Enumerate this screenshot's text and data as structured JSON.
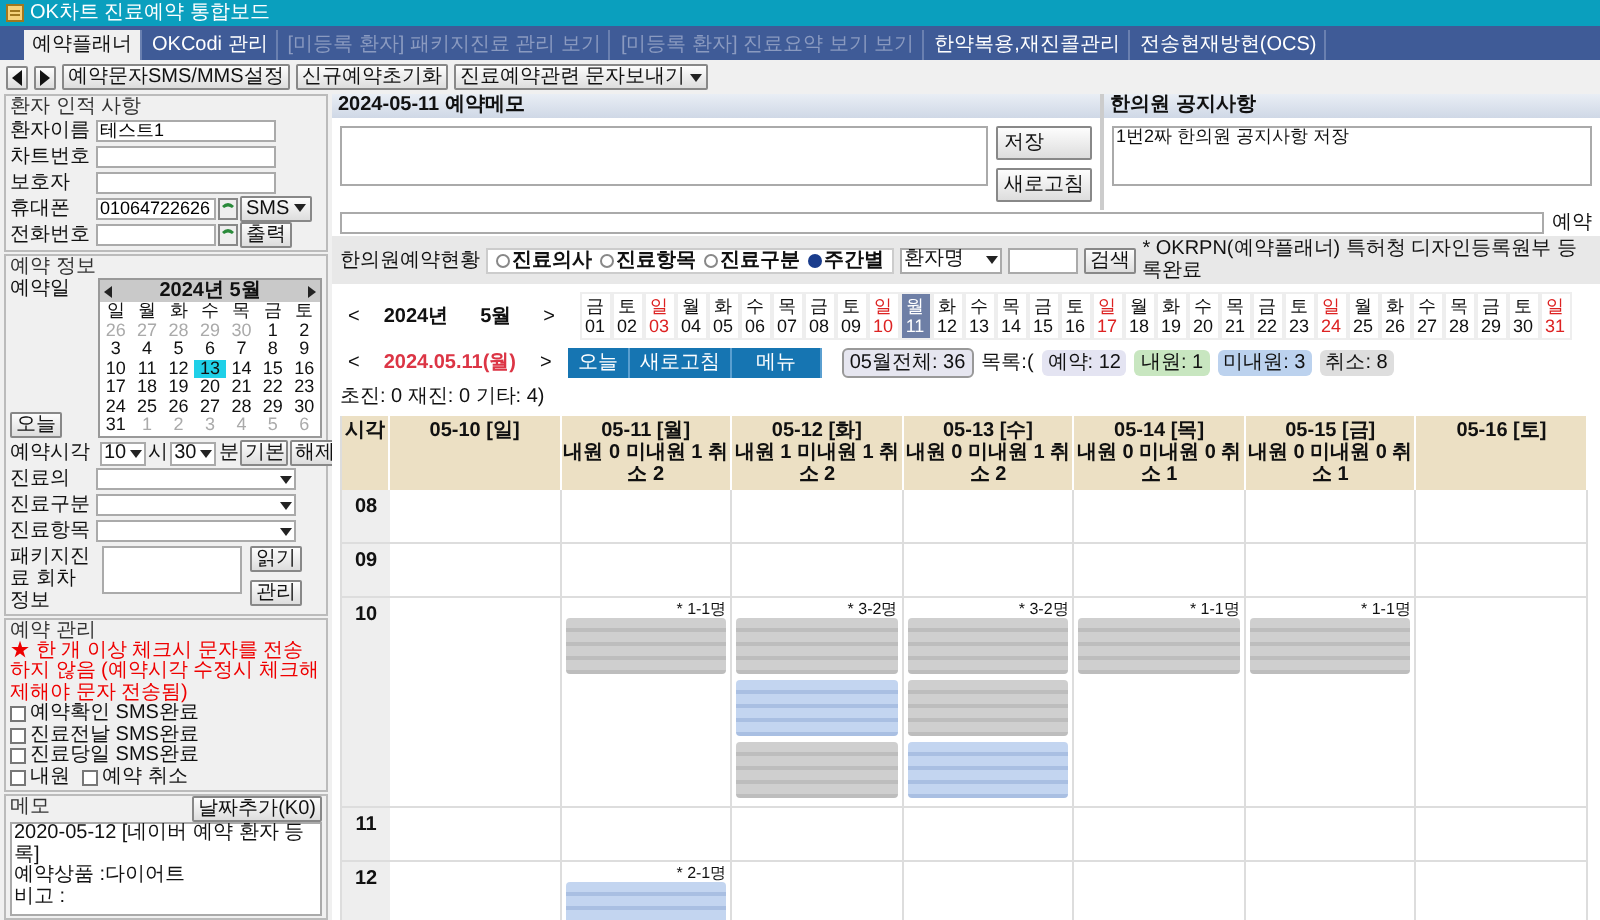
{
  "window": {
    "title": "OK차트 진료예약 통합보드"
  },
  "menu_tabs": [
    {
      "label": "예약플래너",
      "selected": true,
      "disabled": false
    },
    {
      "label": "OKCodi 관리",
      "selected": false,
      "disabled": false
    },
    {
      "label": "[미등록 환자] 패키지진료 관리 보기",
      "selected": false,
      "disabled": true
    },
    {
      "label": "[미등록 환자] 진료요약 보기 보기",
      "selected": false,
      "disabled": true
    },
    {
      "label": "한약복용,재진콜관리",
      "selected": false,
      "disabled": false
    },
    {
      "label": "전송현재방현(OCS)",
      "selected": false,
      "disabled": false
    }
  ],
  "toolbar": {
    "buttons": [
      {
        "kind": "prev"
      },
      {
        "kind": "next"
      },
      {
        "kind": "text",
        "label": "예약문자SMS/MMS설정"
      },
      {
        "kind": "text",
        "label": "신규예약초기화"
      },
      {
        "kind": "dropdown",
        "label": "진료예약관련 문자보내기"
      }
    ]
  },
  "patient": {
    "title": "환자 인적 사항",
    "fields": [
      {
        "label": "환자이름",
        "value": "테스트1",
        "kind": "plain"
      },
      {
        "label": "차트번호",
        "kind": "plain"
      },
      {
        "label": "보호자",
        "kind": "plain"
      },
      {
        "label": "휴대폰",
        "value": "01064722626",
        "kind": "phone",
        "extra": "SMS"
      },
      {
        "label": "전화번호",
        "kind": "phone",
        "extra": "출력"
      }
    ]
  },
  "reservation": {
    "title": "예약 정보",
    "date_label": "예약일",
    "mini_calendar": {
      "title": "2024년 5월",
      "weekdays": [
        "일",
        "월",
        "화",
        "수",
        "목",
        "금",
        "토"
      ],
      "days": [
        {
          "day": "26",
          "other_month": true,
          "selected": false
        },
        {
          "day": "27",
          "other_month": true,
          "selected": false
        },
        {
          "day": "28",
          "other_month": true,
          "selected": false
        },
        {
          "day": "29",
          "other_month": true,
          "selected": false
        },
        {
          "day": "30",
          "other_month": true,
          "selected": false
        },
        {
          "day": "1",
          "other_month": false,
          "selected": false
        },
        {
          "day": "2",
          "other_month": false,
          "selected": false
        },
        {
          "day": "3",
          "other_month": false,
          "selected": false
        },
        {
          "day": "4",
          "other_month": false,
          "selected": false
        },
        {
          "day": "5",
          "other_month": false,
          "selected": false
        },
        {
          "day": "6",
          "other_month": false,
          "selected": false
        },
        {
          "day": "7",
          "other_month": false,
          "selected": false
        },
        {
          "day": "8",
          "other_month": false,
          "selected": false
        },
        {
          "day": "9",
          "other_month": false,
          "selected": false
        },
        {
          "day": "10",
          "other_month": false,
          "selected": false
        },
        {
          "day": "11",
          "other_month": false,
          "selected": false
        },
        {
          "day": "12",
          "other_month": false,
          "selected": false
        },
        {
          "day": "13",
          "other_month": false,
          "selected": true
        },
        {
          "day": "14",
          "other_month": false,
          "selected": false
        },
        {
          "day": "15",
          "other_month": false,
          "selected": false
        },
        {
          "day": "16",
          "other_month": false,
          "selected": false
        },
        {
          "day": "17",
          "other_month": false,
          "selected": false
        },
        {
          "day": "18",
          "other_month": false,
          "selected": false
        },
        {
          "day": "19",
          "other_month": false,
          "selected": false
        },
        {
          "day": "20",
          "other_month": false,
          "selected": false
        },
        {
          "day": "21",
          "other_month": false,
          "selected": false
        },
        {
          "day": "22",
          "other_month": false,
          "selected": false
        },
        {
          "day": "23",
          "other_month": false,
          "selected": false
        },
        {
          "day": "24",
          "other_month": false,
          "selected": false
        },
        {
          "day": "25",
          "other_month": false,
          "selected": false
        },
        {
          "day": "26",
          "other_month": false,
          "selected": false
        },
        {
          "day": "27",
          "other_month": false,
          "selected": false
        },
        {
          "day": "28",
          "other_month": false,
          "selected": false
        },
        {
          "day": "29",
          "other_month": false,
          "selected": false
        },
        {
          "day": "30",
          "other_month": false,
          "selected": false
        },
        {
          "day": "31",
          "other_month": false,
          "selected": false
        },
        {
          "day": "1",
          "other_month": true,
          "selected": false
        },
        {
          "day": "2",
          "other_month": true,
          "selected": false
        },
        {
          "day": "3",
          "other_month": true,
          "selected": false
        },
        {
          "day": "4",
          "other_month": true,
          "selected": false
        },
        {
          "day": "5",
          "other_month": true,
          "selected": false
        },
        {
          "day": "6",
          "other_month": true,
          "selected": false
        }
      ]
    },
    "today_button": "오늘",
    "time": {
      "label": "예약시각",
      "hour": "10",
      "hour_unit": "시",
      "minute": "30",
      "minute_unit": "분",
      "buttons": [
        "기본",
        "해제"
      ]
    },
    "selects": [
      {
        "label": "진료의"
      },
      {
        "label": "진료구분"
      },
      {
        "label": "진료항목"
      }
    ],
    "package": {
      "label": "패키지진료 회차정보",
      "buttons": [
        "읽기",
        "관리"
      ]
    }
  },
  "management": {
    "title": "예약 관리",
    "note": "★ 한 개 이상 체크시 문자를 전송하지 않음 (예약시각 수정시 체크해제해야 문자 전송됨)",
    "checks": [
      {
        "label": "예약확인 SMS완료",
        "checked": false
      },
      {
        "label": "진료전날 SMS완료",
        "checked": false
      },
      {
        "label": "진료당일 SMS완료",
        "checked": false
      },
      {
        "label": "내원",
        "checked": false
      },
      {
        "label": "예약 취소",
        "checked": false
      }
    ]
  },
  "memo": {
    "title": "메모",
    "button": "날짜추가(K0)",
    "lines": [
      "2020-05-12 [네이버 예약 환자 등록]",
      "예약상품 :다이어트",
      "비고 :"
    ]
  },
  "day_memo": {
    "title": "2024-05-11 예약메모",
    "buttons": [
      "저장",
      "새로고침"
    ]
  },
  "notice": {
    "title": "한의원 공지사항",
    "text": "1번2짜 한의원 공지사항 저장"
  },
  "memo_row": {
    "label": "예약"
  },
  "filter": {
    "label": "한의원예약현황",
    "radios": [
      {
        "label": "진료의사",
        "selected": false
      },
      {
        "label": "진료항목",
        "selected": false
      },
      {
        "label": "진료구분",
        "selected": false
      },
      {
        "label": "주간별",
        "selected": true
      }
    ],
    "select": "환자명",
    "search_button": "검색",
    "note": "* OKRPN(예약플래너) 특허청 디자인등록원부 등록완료"
  },
  "month_nav": {
    "prev": "<",
    "year": "2024년",
    "month": "5월",
    "next": ">"
  },
  "date_strip": [
    {
      "weekday": "금",
      "day": "01",
      "selected": false,
      "holiday": false
    },
    {
      "weekday": "토",
      "day": "02",
      "selected": false,
      "holiday": false
    },
    {
      "weekday": "일",
      "day": "03",
      "selected": false,
      "holiday": true
    },
    {
      "weekday": "월",
      "day": "04",
      "selected": false,
      "holiday": false
    },
    {
      "weekday": "화",
      "day": "05",
      "selected": false,
      "holiday": false
    },
    {
      "weekday": "수",
      "day": "06",
      "selected": false,
      "holiday": false
    },
    {
      "weekday": "목",
      "day": "07",
      "selected": false,
      "holiday": false
    },
    {
      "weekday": "금",
      "day": "08",
      "selected": false,
      "holiday": false
    },
    {
      "weekday": "토",
      "day": "09",
      "selected": false,
      "holiday": false
    },
    {
      "weekday": "일",
      "day": "10",
      "selected": false,
      "holiday": true
    },
    {
      "weekday": "월",
      "day": "11",
      "selected": true,
      "holiday": false
    },
    {
      "weekday": "화",
      "day": "12",
      "selected": false,
      "holiday": false
    },
    {
      "weekday": "수",
      "day": "13",
      "selected": false,
      "holiday": false
    },
    {
      "weekday": "목",
      "day": "14",
      "selected": false,
      "holiday": false
    },
    {
      "weekday": "금",
      "day": "15",
      "selected": false,
      "holiday": false
    },
    {
      "weekday": "토",
      "day": "16",
      "selected": false,
      "holiday": false
    },
    {
      "weekday": "일",
      "day": "17",
      "selected": false,
      "holiday": true
    },
    {
      "weekday": "월",
      "day": "18",
      "selected": false,
      "holiday": false
    },
    {
      "weekday": "화",
      "day": "19",
      "selected": false,
      "holiday": false
    },
    {
      "weekday": "수",
      "day": "20",
      "selected": false,
      "holiday": false
    },
    {
      "weekday": "목",
      "day": "21",
      "selected": false,
      "holiday": false
    },
    {
      "weekday": "금",
      "day": "22",
      "selected": false,
      "holiday": false
    },
    {
      "weekday": "토",
      "day": "23",
      "selected": false,
      "holiday": false
    },
    {
      "weekday": "일",
      "day": "24",
      "selected": false,
      "holiday": true
    },
    {
      "weekday": "월",
      "day": "25",
      "selected": false,
      "holiday": false
    },
    {
      "weekday": "화",
      "day": "26",
      "selected": false,
      "holiday": false
    },
    {
      "weekday": "수",
      "day": "27",
      "selected": false,
      "holiday": false
    },
    {
      "weekday": "목",
      "day": "28",
      "selected": false,
      "holiday": false
    },
    {
      "weekday": "금",
      "day": "29",
      "selected": false,
      "holiday": false
    },
    {
      "weekday": "토",
      "day": "30",
      "selected": false,
      "holiday": false
    },
    {
      "weekday": "일",
      "day": "31",
      "selected": false,
      "holiday": true
    }
  ],
  "day_nav": {
    "prev": "<",
    "date": "2024.05.11(월)",
    "next": ">",
    "buttons": [
      "오늘",
      "새로고침",
      "메뉴"
    ]
  },
  "stats": [
    {
      "kind": "total",
      "text": "05월전체: 36"
    },
    {
      "kind": "label",
      "text": "목록:("
    },
    {
      "kind": "booked",
      "text": "예약: 12"
    },
    {
      "kind": "visited",
      "text": "내원: 1"
    },
    {
      "kind": "absent",
      "text": "미내원: 3"
    },
    {
      "kind": "cancelled",
      "text": "취소: 8"
    },
    {
      "kind": "label",
      "text": "초진: 0  재진: 0  기타: 4)"
    }
  ],
  "schedule": {
    "time_header": "시각",
    "columns": [
      {
        "date": "05-10 [일]"
      },
      {
        "date": "05-11 [월]",
        "summary": "내원 0 미내원 1 취소 2"
      },
      {
        "date": "05-12 [화]",
        "summary": "내원 1 미내원 1 취소 2"
      },
      {
        "date": "05-13 [수]",
        "summary": "내원 0 미내원 1 취소 2"
      },
      {
        "date": "05-14 [목]",
        "summary": "내원 0 미내원 0 취소 1"
      },
      {
        "date": "05-15 [금]",
        "summary": "내원 0 미내원 0 취소 1"
      },
      {
        "date": "05-16 [토]"
      }
    ],
    "hours": [
      {
        "time": "08",
        "cells": [
          {},
          {},
          {},
          {},
          {},
          {},
          {}
        ]
      },
      {
        "time": "09",
        "cells": [
          {},
          {},
          {},
          {},
          {},
          {},
          {}
        ]
      },
      {
        "time": "10",
        "cells": [
          {},
          {
            "count": "* 1-1명",
            "cards": [
              {
                "kind": "cancelled"
              }
            ]
          },
          {
            "count": "* 3-2명",
            "cards": [
              {
                "kind": "cancelled"
              },
              {
                "kind": "booked"
              },
              {
                "kind": "cancelled"
              }
            ]
          },
          {
            "count": "* 3-2명",
            "cards": [
              {
                "kind": "cancelled"
              },
              {
                "kind": "cancelled"
              },
              {
                "kind": "booked"
              }
            ]
          },
          {
            "count": "* 1-1명",
            "cards": [
              {
                "kind": "cancelled"
              }
            ]
          },
          {
            "count": "* 1-1명",
            "cards": [
              {
                "kind": "cancelled"
              }
            ]
          },
          {}
        ]
      },
      {
        "time": "11",
        "cells": [
          {},
          {},
          {},
          {},
          {},
          {},
          {}
        ]
      },
      {
        "time": "12",
        "cells": [
          {},
          {
            "count": "* 2-1명",
            "cards": [
              {
                "kind": "booked"
              }
            ]
          },
          {},
          {},
          {},
          {},
          {}
        ]
      }
    ]
  }
}
